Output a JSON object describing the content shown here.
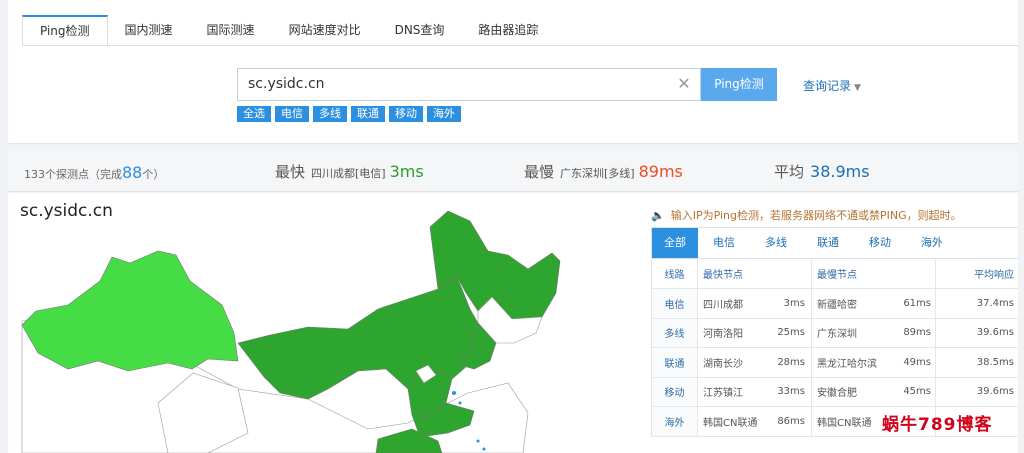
{
  "tabs": [
    {
      "label": "Ping检测",
      "active": true
    },
    {
      "label": "国内测速"
    },
    {
      "label": "国际测速"
    },
    {
      "label": "网站速度对比"
    },
    {
      "label": "DNS查询"
    },
    {
      "label": "路由器追踪"
    }
  ],
  "search": {
    "value": "sc.ysidc.cn",
    "button": "Ping检测",
    "history": "查询记录"
  },
  "filters": [
    "全选",
    "电信",
    "多线",
    "联通",
    "移动",
    "海外"
  ],
  "stats": {
    "count_prefix": "133个探测点（完成",
    "count_done": "88",
    "count_suffix": "个）",
    "fastest": {
      "label": "最快",
      "location": "四川成都[电信]",
      "value": "3ms"
    },
    "slowest": {
      "label": "最慢",
      "location": "广东深圳[多线]",
      "value": "89ms"
    },
    "average": {
      "label": "平均",
      "value": "38.9ms"
    }
  },
  "domain": "sc.ysidc.cn",
  "notice": "输入IP为Ping检测，若服务器网络不通或禁PING，则超时。",
  "result_tabs": [
    "全部",
    "电信",
    "多线",
    "联通",
    "移动",
    "海外"
  ],
  "table": {
    "headers": [
      "线路",
      "最快节点",
      "最慢节点",
      "平均响应"
    ],
    "rows": [
      {
        "line": "电信",
        "fast_node": "四川成都",
        "fast_val": "3ms",
        "slow_node": "新疆哈密",
        "slow_val": "61ms",
        "avg": "37.4ms"
      },
      {
        "line": "多线",
        "fast_node": "河南洛阳",
        "fast_val": "25ms",
        "slow_node": "广东深圳",
        "slow_val": "89ms",
        "avg": "39.6ms"
      },
      {
        "line": "联通",
        "fast_node": "湖南长沙",
        "fast_val": "28ms",
        "slow_node": "黑龙江哈尔滨",
        "slow_val": "49ms",
        "avg": "38.5ms"
      },
      {
        "line": "移动",
        "fast_node": "江苏镇江",
        "fast_val": "33ms",
        "slow_node": "安徽合肥",
        "slow_val": "45ms",
        "avg": "39.6ms"
      },
      {
        "line": "海外",
        "fast_node": "韩国CN联通",
        "fast_val": "86ms",
        "slow_node": "韩国CN联通",
        "slow_val": "",
        "avg": ""
      }
    ]
  },
  "watermark": "蜗牛789博客",
  "colors": {
    "accent": "#2d8fe0",
    "map_dark": "#2ea52e",
    "map_light": "#46dc46",
    "fast": "#2a9d2a",
    "slow": "#ee4a24"
  }
}
